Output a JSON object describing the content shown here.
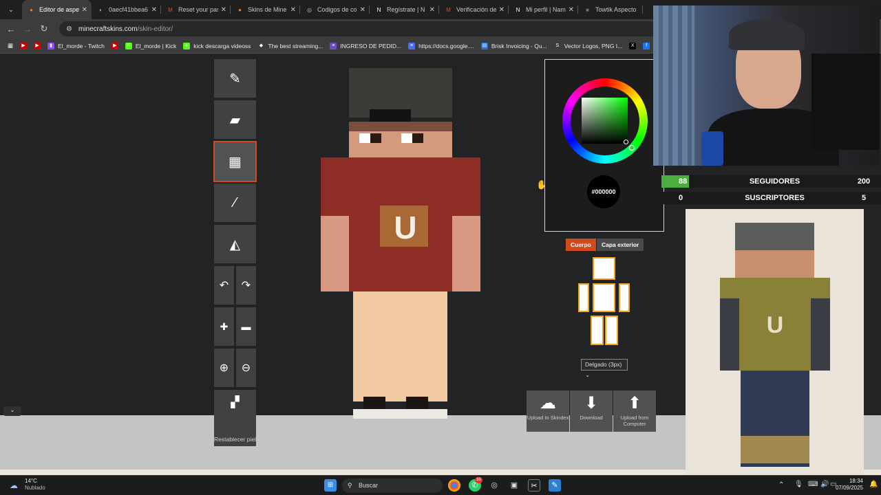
{
  "browser": {
    "tabs": [
      {
        "title": "Editor de aspe",
        "color": "#e07a2c",
        "glyph": "●"
      },
      {
        "title": "0aecf41bbea6",
        "color": "#aaaaaa",
        "glyph": "◐"
      },
      {
        "title": "Reset your pas",
        "color": "#ea4335",
        "glyph": "M"
      },
      {
        "title": "Skins de Mine",
        "color": "#e07a2c",
        "glyph": "●"
      },
      {
        "title": "Codigos de co",
        "color": "#bbbbbb",
        "glyph": "◎"
      },
      {
        "title": "Regístrate | N",
        "color": "#ffffff",
        "glyph": "N"
      },
      {
        "title": "Verificación de",
        "color": "#ea4335",
        "glyph": "M"
      },
      {
        "title": "Mi perfil | Nam",
        "color": "#ffffff",
        "glyph": "N"
      },
      {
        "title": "Towtik Aspecto",
        "color": "#8a6a4a",
        "glyph": "■"
      }
    ],
    "url_domain": "minecraftskins.com",
    "url_path": "/skin-editor/",
    "bookmarks": [
      {
        "label": "",
        "color": "#cc0000",
        "glyph": "▶"
      },
      {
        "label": "",
        "color": "#cc0000",
        "glyph": "▶"
      },
      {
        "label": "El_morde - Twitch",
        "color": "#9146ff",
        "glyph": "▮"
      },
      {
        "label": "",
        "color": "#cc0000",
        "glyph": "▶"
      },
      {
        "label": "El_morde | Kick",
        "color": "#53fc18",
        "glyph": "K"
      },
      {
        "label": "kick descarga videoss",
        "color": "#53fc18",
        "glyph": "●"
      },
      {
        "label": "The best streaming...",
        "color": "#ffffff",
        "glyph": "◆"
      },
      {
        "label": "INGRESO DE PEDID...",
        "color": "#6b4cc8",
        "glyph": "≡"
      },
      {
        "label": "https://docs.google....",
        "color": "#4a6cf7",
        "glyph": "≡"
      },
      {
        "label": "Brisk Invoicing - Qu...",
        "color": "#2a6fd6",
        "glyph": "▤"
      },
      {
        "label": "Vector Logos, PNG I...",
        "color": "#ffffff",
        "glyph": "S"
      },
      {
        "label": "",
        "color": "#000000",
        "glyph": "X"
      },
      {
        "label": "",
        "color": "#1877f2",
        "glyph": "f"
      },
      {
        "label": "",
        "color": "#d62976",
        "glyph": "◎"
      }
    ]
  },
  "editor": {
    "tools": [
      {
        "name": "pencil",
        "glyph": "✎"
      },
      {
        "name": "eraser",
        "glyph": "▰"
      },
      {
        "name": "noise-brush",
        "glyph": "▦"
      },
      {
        "name": "eyedropper",
        "glyph": "⁄"
      },
      {
        "name": "bucket",
        "glyph": "◭"
      }
    ],
    "undo_glyph": "↶",
    "redo_glyph": "↷",
    "reset_label": "Restablecer piel",
    "color_hex": "#000000",
    "tab_body": "Cuerpo",
    "tab_layer": "Capa exterior",
    "model_select": "Delgado (3px)",
    "actions": [
      {
        "label": "Upload to Skindex",
        "glyph": "☁"
      },
      {
        "label": "Download",
        "glyph": "⬇"
      },
      {
        "label": "Upload from Computer",
        "glyph": "⬆"
      }
    ]
  },
  "overlay": {
    "followers_current": "88",
    "followers_label": "SEGUIDORES",
    "followers_goal": "200",
    "subs_current": "0",
    "subs_label": "SUSCRIPTORES",
    "subs_goal": "5",
    "followers_progress": 0.44
  },
  "taskbar": {
    "temperature": "14°C",
    "weather": "Nublado",
    "search_placeholder": "Buscar",
    "time": "18:34",
    "date": "07/09/2025",
    "whatsapp_badge": "10"
  }
}
